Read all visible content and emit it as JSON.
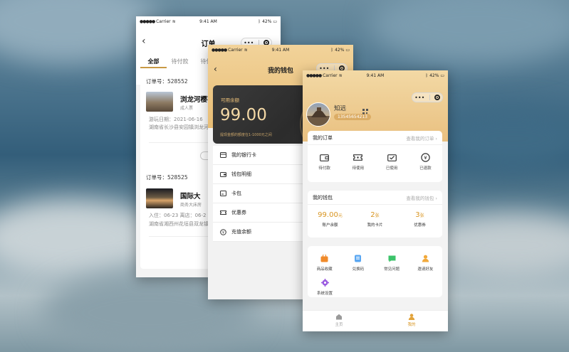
{
  "status_bar": {
    "carrier": "Carrier",
    "time": "9:41 AM",
    "battery": "42%"
  },
  "capsule": {
    "more": "•••"
  },
  "orders_screen": {
    "title": "订单",
    "back": "‹",
    "tabs": [
      "全部",
      "待付款",
      "待使"
    ],
    "orders": [
      {
        "number_label": "订单号：",
        "number": "528552",
        "product": "浏龙河樱花",
        "type": "成人票",
        "line1": "游玩日期：2021-06-16",
        "line2": "湖南省长沙县安园镇浏龙河"
      },
      {
        "number_label": "订单号：",
        "number": "528525",
        "product": "国际大",
        "type": "商务大床房",
        "line1": "入住：06-23    离店：06-2",
        "line2": "湖南省湘西州花垣县双龙镇"
      }
    ]
  },
  "wallet_screen": {
    "title": "我的钱包",
    "back": "‹",
    "balance_label": "可用余额",
    "balance": "99.00",
    "note": "提现金额的额度在1-1000元之间",
    "menu": [
      "我的银行卡",
      "钱包明细",
      "卡包",
      "优惠券",
      "充值余额"
    ]
  },
  "mine_screen": {
    "user_name": "知远",
    "user_phone": "13545654213",
    "orders_panel": {
      "title": "我的订单",
      "more": "查看我的订单 ›",
      "items": [
        "待付款",
        "待使用",
        "已使用",
        "已退款"
      ]
    },
    "wallet_panel": {
      "title": "我的钱包",
      "more": "查看我的钱包 ›",
      "stats": [
        {
          "value": "99.00",
          "unit": "元",
          "label": "账户余额"
        },
        {
          "value": "2",
          "unit": "张",
          "label": "我的卡片"
        },
        {
          "value": "3",
          "unit": "张",
          "label": "优惠券"
        }
      ]
    },
    "tools": [
      "商品收藏",
      "兑换码",
      "常见问题",
      "邀请好友",
      "系统设置"
    ],
    "tabbar": [
      "主页",
      "我的"
    ]
  },
  "colors": {
    "accent": "#d8941f",
    "gold_light": "#f2d39a",
    "card_dark": "#2f2f2f"
  }
}
